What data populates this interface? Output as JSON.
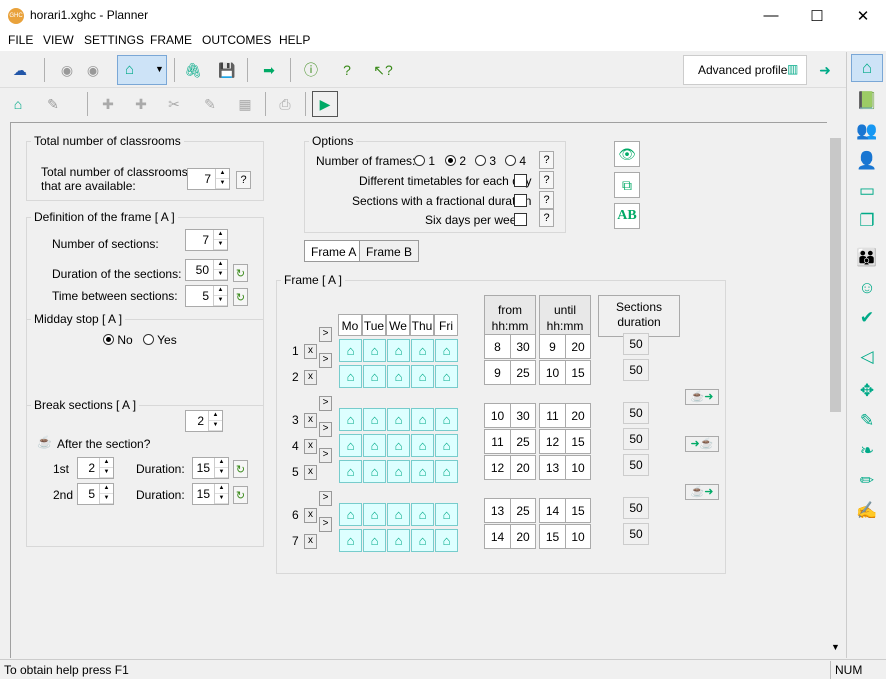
{
  "window": {
    "title": "horari1.xghc - Planner",
    "min": "—",
    "max": "☐",
    "close": "✕"
  },
  "menu": [
    "FILE",
    "VIEW",
    "SETTINGS",
    "FRAME",
    "OUTCOMES",
    "HELP"
  ],
  "profile": {
    "label": "Advanced profile"
  },
  "classrooms": {
    "group": "Total number of classrooms",
    "label1": "Total number of classrooms",
    "label2": "that are available:",
    "value": "7"
  },
  "frame_def": {
    "group": "Definition of the frame [ A ]",
    "num_sections_label": "Number of sections:",
    "num_sections": "7",
    "duration_label": "Duration of the sections:",
    "duration": "50",
    "between_label": "Time between sections:",
    "between": "5"
  },
  "midday": {
    "group": "Midday stop [ A ]",
    "no": "No",
    "yes": "Yes",
    "selected": "No"
  },
  "breaks": {
    "group": "Break sections [ A ]",
    "count": "2",
    "after_label": "After the section?",
    "first_label": "1st",
    "first": "2",
    "second_label": "2nd",
    "second": "5",
    "duration_label": "Duration:",
    "first_duration": "15",
    "second_duration": "15"
  },
  "options": {
    "group": "Options",
    "frames_label": "Number of frames:",
    "frames_options": [
      "1",
      "2",
      "3",
      "4"
    ],
    "frames_selected": "2",
    "different_label": "Different timetables for each day",
    "fractional_label": "Sections with a fractional duration",
    "sixdays_label": "Six days per week",
    "ab": "AB"
  },
  "tabs": [
    "Frame A",
    "Frame B"
  ],
  "frame": {
    "group": "Frame [ A ]",
    "days": [
      "Mo",
      "Tue",
      "We",
      "Thu",
      "Fri"
    ],
    "from_header": [
      "from",
      "hh:mm"
    ],
    "until_header": [
      "until",
      "hh:mm"
    ],
    "dur_header": [
      "Sections",
      "duration"
    ],
    "rows": [
      {
        "n": "1",
        "fh": "8",
        "fm": "30",
        "uh": "9",
        "um": "20",
        "d": "50"
      },
      {
        "n": "2",
        "fh": "9",
        "fm": "25",
        "uh": "10",
        "um": "15",
        "d": "50"
      },
      {
        "n": "3",
        "fh": "10",
        "fm": "30",
        "uh": "11",
        "um": "20",
        "d": "50"
      },
      {
        "n": "4",
        "fh": "11",
        "fm": "25",
        "uh": "12",
        "um": "15",
        "d": "50"
      },
      {
        "n": "5",
        "fh": "12",
        "fm": "20",
        "uh": "13",
        "um": "10",
        "d": "50"
      },
      {
        "n": "6",
        "fh": "13",
        "fm": "25",
        "uh": "14",
        "um": "15",
        "d": "50"
      },
      {
        "n": "7",
        "fh": "14",
        "fm": "20",
        "uh": "15",
        "um": "10",
        "d": "50"
      }
    ],
    "x_label": "x",
    "arrow_label": ">"
  },
  "status": {
    "help": "To obtain help press F1",
    "num": "NUM"
  }
}
